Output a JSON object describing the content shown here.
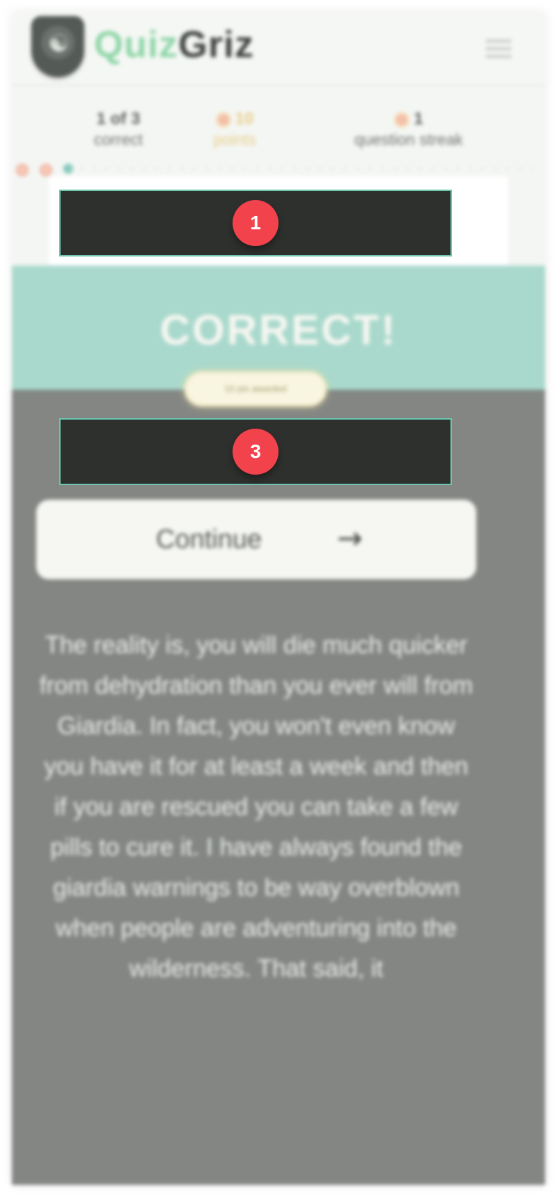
{
  "header": {
    "logo_text_a": "Quiz",
    "logo_text_b": "Griz",
    "logo_glyph": "☯",
    "menu_icon": "hamburger-menu-icon"
  },
  "stats": {
    "correct_value": "1 of 3",
    "correct_label": "correct",
    "points_value": "10",
    "points_label": "points",
    "streak_value": "1",
    "streak_label": "question streak"
  },
  "markers": {
    "first": "1",
    "second": "3"
  },
  "result": {
    "title": "CORRECT!",
    "points_badge": "10 pts awarded"
  },
  "continue_button": {
    "label": "Continue",
    "icon": "arrow-right-icon",
    "glyph": "→"
  },
  "explanation": "The reality is, you will die much quicker from dehydration than you ever will from Giardia. In fact, you won't even know you have it for at least a week and then if you are rescued you can take a few pills to cure it. I have always found the giardia warnings to be way overblown when people are adventuring into the wilderness. That said, it",
  "colors": {
    "accent_mint": "#a9d9cc",
    "overlay_gray": "#838683",
    "marker_red": "#f2424c",
    "points_gold": "#e8cd8b"
  }
}
